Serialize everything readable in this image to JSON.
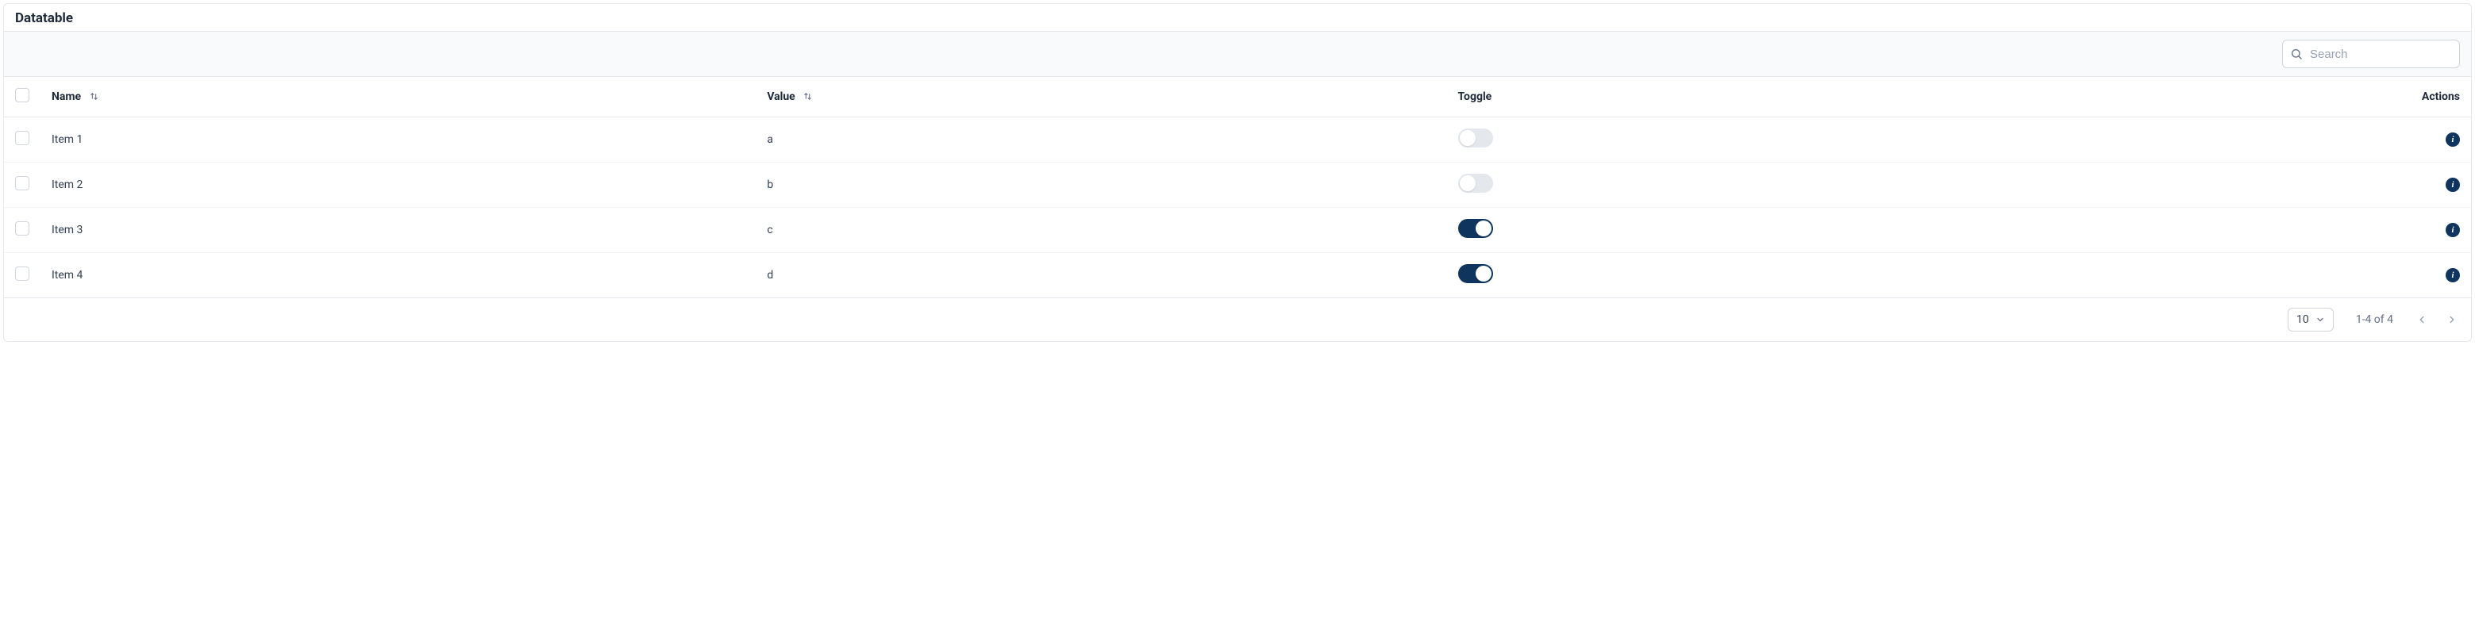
{
  "title": "Datatable",
  "search": {
    "placeholder": "Search"
  },
  "columns": {
    "name": "Name",
    "value": "Value",
    "toggle": "Toggle",
    "actions": "Actions"
  },
  "rows": [
    {
      "name": "Item 1",
      "value": "a",
      "toggle": false
    },
    {
      "name": "Item 2",
      "value": "b",
      "toggle": false
    },
    {
      "name": "Item 3",
      "value": "c",
      "toggle": true
    },
    {
      "name": "Item 4",
      "value": "d",
      "toggle": true
    }
  ],
  "pagination": {
    "page_size": "10",
    "range": "1-4 of 4"
  }
}
